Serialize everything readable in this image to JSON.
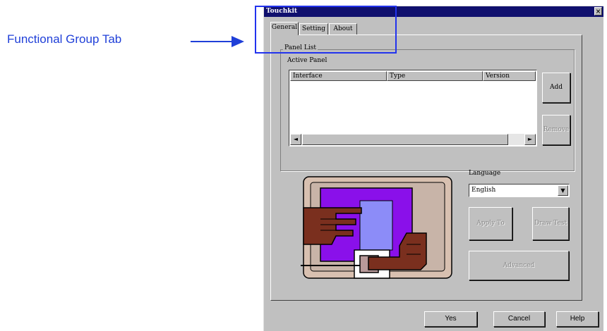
{
  "annotation": {
    "label": "Functional Group Tab"
  },
  "window": {
    "title": "Touchkit",
    "close_glyph": "×"
  },
  "tabs": [
    {
      "label": "General"
    },
    {
      "label": "Setting"
    },
    {
      "label": "About"
    }
  ],
  "panel_list": {
    "group_label": "Panel List",
    "active_label": "Active Panel",
    "columns": [
      "Interface",
      "Type",
      "Version"
    ],
    "rows": [],
    "scroll_left": "◄",
    "scroll_right": "►",
    "add_label": "Add",
    "remove_label": "Remove"
  },
  "language": {
    "label": "Language",
    "selected": "English",
    "arrow": "▼"
  },
  "buttons": {
    "apply_to": "Apply To",
    "draw_test": "Draw Test",
    "advanced": "Advanced"
  },
  "footer": {
    "yes": "Yes",
    "cancel": "Cancel",
    "help": "Help"
  },
  "colors": {
    "titlebar": "#10106e",
    "annotation": "#1f3fd8",
    "dialog": "#c0c0c0",
    "screen_purple": "#8a10ea",
    "screen_blue": "#8c8cf8",
    "hand_brown": "#7a2f1e"
  },
  "icons": {
    "arrow": "right-arrow-icon",
    "illustration": "touch-screen-illustration"
  }
}
